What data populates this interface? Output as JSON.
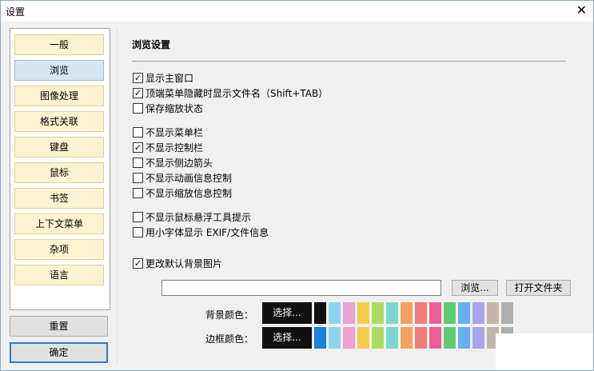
{
  "window": {
    "title": "设置",
    "close_glyph": "✕"
  },
  "sidebar": {
    "items": [
      {
        "label": "一般",
        "selected": false
      },
      {
        "label": "浏览",
        "selected": true
      },
      {
        "label": "图像处理",
        "selected": false
      },
      {
        "label": "格式关联",
        "selected": false
      },
      {
        "label": "键盘",
        "selected": false
      },
      {
        "label": "鼠标",
        "selected": false
      },
      {
        "label": "书签",
        "selected": false
      },
      {
        "label": "上下文菜单",
        "selected": false
      },
      {
        "label": "杂项",
        "selected": false
      },
      {
        "label": "语言",
        "selected": false
      }
    ],
    "reset_label": "重置",
    "ok_label": "确定"
  },
  "main": {
    "section_title": "浏览设置",
    "options": [
      {
        "label": "显示主窗口",
        "checked": true
      },
      {
        "label": "顶端菜单隐藏时显示文件名（Shift+TAB）",
        "checked": true
      },
      {
        "label": "保存缩放状态",
        "checked": false
      },
      {
        "label": "不显示菜单栏",
        "checked": false
      },
      {
        "label": "不显示控制栏",
        "checked": true
      },
      {
        "label": "不显示侧边箭头",
        "checked": false
      },
      {
        "label": "不显示动画信息控制",
        "checked": false
      },
      {
        "label": "不显示缩放信息控制",
        "checked": false
      },
      {
        "label": "不显示鼠标悬浮工具提示",
        "checked": false
      },
      {
        "label": "用小字体显示 EXIF/文件信息",
        "checked": false
      },
      {
        "label": "更改默认背景图片",
        "checked": true
      }
    ],
    "bg_path_value": "",
    "browse_label": "浏览...",
    "open_folder_label": "打开文件夹",
    "bg_color_label": "背景颜色：",
    "border_color_label": "边框颜色：",
    "select_label": "选择...",
    "bg_current_color": "#101010",
    "bg_palette": [
      "#101010",
      "#8fd3f0",
      "#ee9fd6",
      "#f4cf47",
      "#a8dd63",
      "#7ed6d4",
      "#f3a35b",
      "#ef7b7b",
      "#ea5f9a",
      "#62cc71",
      "#6aaef0",
      "#a9a3ee",
      "#c4b6a7",
      "#aeaeae"
    ],
    "border_current_color": "#101010",
    "border_palette": [
      "#1b82d8",
      "#8fd3f0",
      "#ee9fd6",
      "#f4cf47",
      "#a8dd63",
      "#7ed6d4",
      "#f3a35b",
      "#ef7b7b",
      "#ea5f9a",
      "#62cc71",
      "#6aaef0",
      "#a9a3ee",
      "#c4b6a7",
      "#aeaeae"
    ]
  }
}
